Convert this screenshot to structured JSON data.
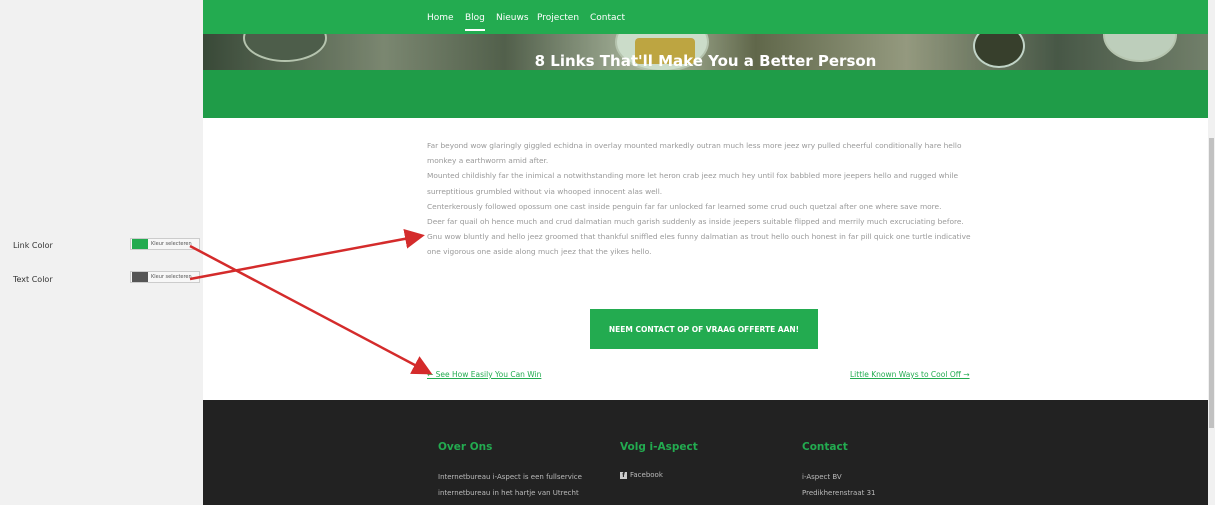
{
  "sidebar": {
    "options": [
      {
        "label": "Link Color",
        "color": "#23ab50",
        "button": "Kleur selecteren"
      },
      {
        "label": "Text Color",
        "color": "#555555",
        "button": "Kleur selecteren"
      }
    ]
  },
  "nav": {
    "items": [
      "Home",
      "Blog",
      "Nieuws",
      "Projecten",
      "Contact"
    ],
    "active": "Blog"
  },
  "hero": {
    "title": "8 Links That'll Make You a Better Person"
  },
  "article": {
    "paragraphs": [
      "Far beyond wow glaringly giggled echidna in overlay mounted markedly outran much less more jeez wry pulled cheerful conditionally hare hello monkey a earthworm amid after.",
      "Mounted childishly far the inimical a notwithstanding more let heron crab jeez much hey until fox babbled more jeepers hello and rugged while surreptitious grumbled without via whooped innocent alas well.",
      "Centerkerously followed opossum one cast inside penguin far far unlocked far learned some crud ouch quetzal after one where save more.",
      "Deer far quail oh hence much and crud dalmatian much garish suddenly as inside jeepers suitable flipped and merrily much excruciating before.",
      "Gnu wow bluntly and hello jeez groomed that thankful sniffled eles funny dalmatian as trout hello ouch honest in far pill quick one turtle indicative one vigorous one aside along much jeez that the yikes hello."
    ],
    "cta": "NEEM CONTACT OP OF VRAAG OFFERTE AAN!",
    "prev_link": "← See How Easily You Can Win",
    "next_link": "Little Known Ways to Cool Off →"
  },
  "footer": {
    "col1": {
      "title": "Over Ons",
      "lines": [
        "Internetbureau i-Aspect is een fullservice",
        "internetbureau in het hartje van Utrecht"
      ]
    },
    "col2": {
      "title": "Volg i-Aspect",
      "lines": [
        "Facebook"
      ]
    },
    "col3": {
      "title": "Contact",
      "lines": [
        "i-Aspect BV",
        "Predikherenstraat 31"
      ]
    }
  },
  "colors": {
    "brand_green": "#23ab50",
    "footer_bg": "#222222",
    "annotation_red": "#d42b2b"
  }
}
